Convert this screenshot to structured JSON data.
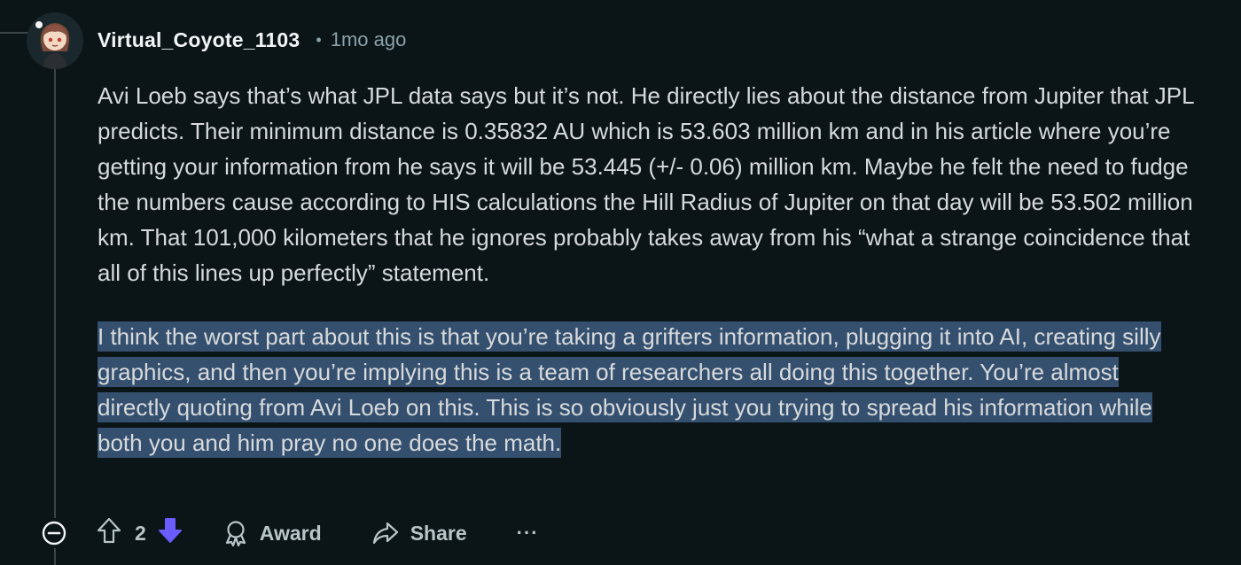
{
  "comment": {
    "username": "Virtual_Coyote_1103",
    "separator": "•",
    "time": "1mo ago",
    "paragraph1": "Avi Loeb says that’s what JPL data says but it’s not. He directly lies about the distance from Jupiter that JPL predicts. Their minimum distance is 0.35832 AU which is 53.603 million km and in his article where you’re getting your information from he says it will be 53.445 (+/- 0.06) million km. Maybe he felt the need to fudge the numbers cause according to HIS calculations the Hill Radius of Jupiter on that day will be 53.502 million km. That 101,000 kilometers that he ignores probably takes away from his “what a strange coincidence that all of this lines up perfectly” statement.",
    "paragraph2": "I think the worst part about this is that you’re taking a grifters information, plugging it into AI, creating silly graphics, and then you’re implying this is a team of researchers all doing this together. You’re almost directly quoting from Avi Loeb on this. This is so obviously just you trying to spread his information while both you and him pray no one does the math."
  },
  "actions": {
    "vote_count": "2",
    "award_label": "Award",
    "share_label": "Share",
    "more_label": "···"
  },
  "icons": {
    "collapse": "minus-circle-icon",
    "upvote": "upvote-arrow-icon",
    "downvote": "downvote-arrow-icon",
    "award": "award-icon",
    "share": "share-arrow-icon",
    "more": "ellipsis-icon"
  },
  "colors": {
    "background": "#0b1416",
    "highlight": "#35506f",
    "downvote_active": "#6a5cff",
    "muted": "#8ba2ad"
  }
}
